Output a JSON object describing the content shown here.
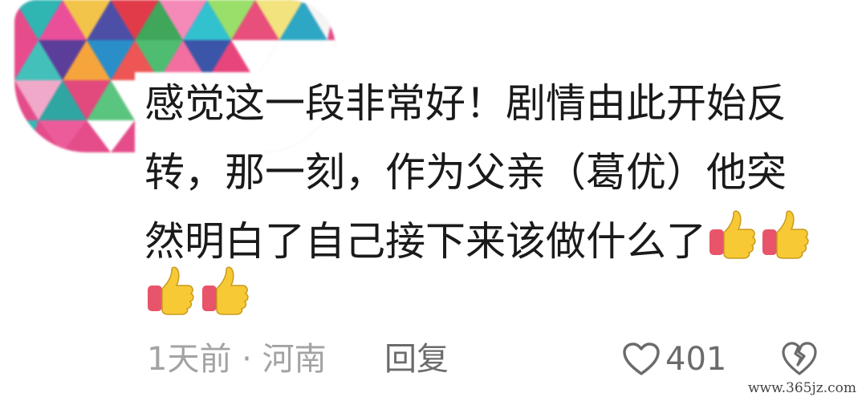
{
  "comment": {
    "line1": "感觉这一段非常好！剧情由此开始反",
    "line2": "转，那一刻，作为父亲（葛优）他突",
    "line3": "然明白了自己接下来该做什么了",
    "thumb_emoji_name": "thumbs-up-emoji"
  },
  "meta": {
    "time_location": "1天前 · 河南",
    "reply_label": "回复",
    "like_count": "401"
  },
  "watermark": "www.365jz.com",
  "colors": {
    "text": "#1a1a1a",
    "meta_text": "#a3a3a3",
    "action_text": "#6b6b6b"
  }
}
